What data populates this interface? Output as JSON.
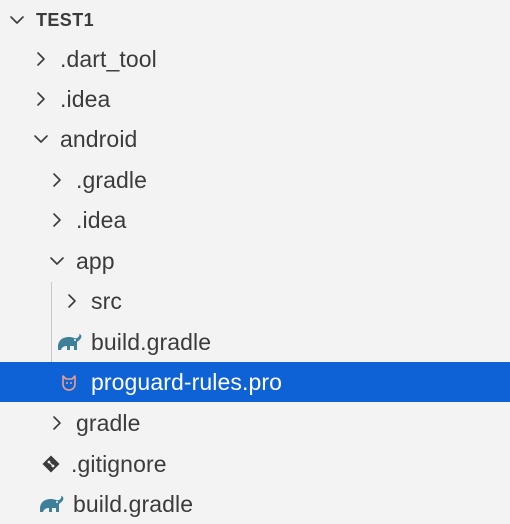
{
  "section": {
    "title": "TEST1"
  },
  "tree": {
    "dart_tool": ".dart_tool",
    "idea_root": ".idea",
    "android": "android",
    "gradle_hidden": ".gradle",
    "idea_android": ".idea",
    "app": "app",
    "src": "src",
    "app_build_gradle": "build.gradle",
    "proguard": "proguard-rules.pro",
    "gradle_folder": "gradle",
    "gitignore": ".gitignore",
    "root_build_gradle": "build.gradle"
  },
  "icons": {
    "collapsed": "chevron-right-icon",
    "expanded": "chevron-down-icon",
    "gradle": "gradle-elephant-icon",
    "proguard": "proguard-icon",
    "git": "git-icon"
  },
  "colors": {
    "background": "#f3f3f3",
    "selection": "#0f62d6",
    "gradle_icon": "#3e7f9a",
    "git_icon": "#3b3b3b"
  },
  "selected_item": "proguard-rules.pro"
}
